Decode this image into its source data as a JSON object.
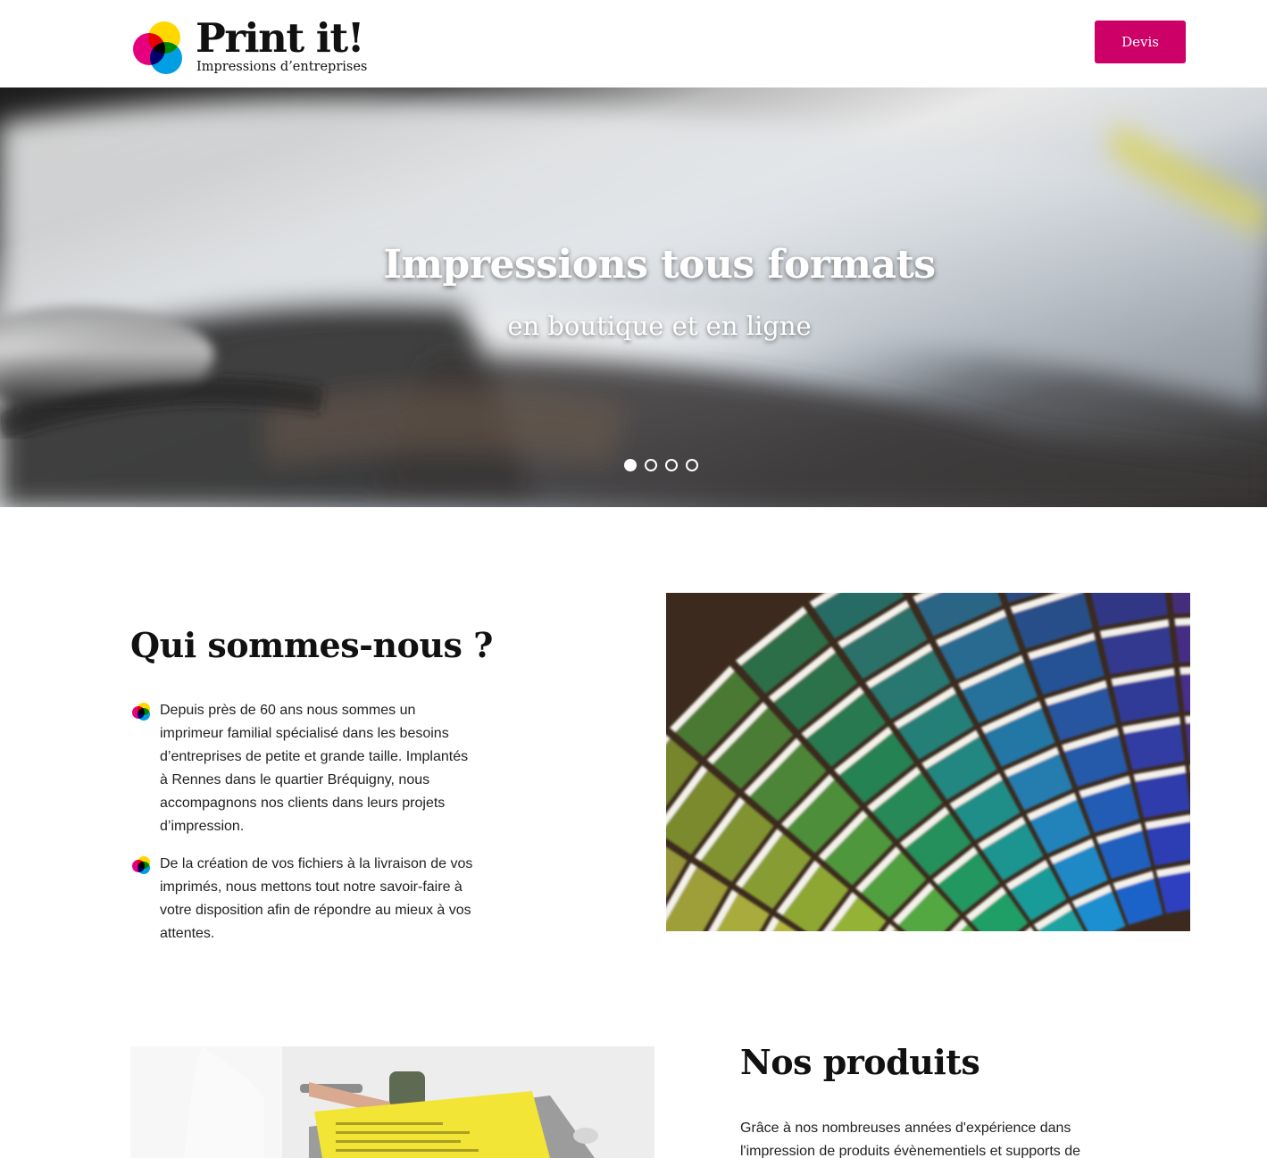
{
  "header": {
    "logo_title": "Print it!",
    "logo_subtitle": "Impressions d’entreprises",
    "cta_label": "Devis"
  },
  "hero": {
    "title": "Impressions tous formats",
    "subtitle": "en boutique et en ligne",
    "slide_count": 4,
    "active_slide": 1
  },
  "about": {
    "title": "Qui sommes-nous ?",
    "items": [
      "Depuis près de 60 ans nous sommes un imprimeur familial spécialisé dans les besoins d’entreprises de petite et grande taille. Implantés à Rennes dans le quartier Bréquigny, nous accompagnons nos clients dans leurs projets d’impression.",
      "De la création de vos fichiers à la livraison de vos imprimés, nous mettons tout notre savoir-faire à votre disposition afin de répondre au mieux à vos attentes."
    ]
  },
  "products": {
    "title": "Nos produits",
    "text": "Grâce à nos nombreuses années d'expérience dans l'impression de produits évènementiels et supports de"
  },
  "colors": {
    "brand_magenta": "#cc0066",
    "logo_yellow": "#ffd800",
    "logo_magenta": "#e6007e",
    "logo_cyan": "#009fe3"
  },
  "icons": {
    "bullet": "cmyk-circles-icon",
    "logo": "cmyk-logo-icon"
  }
}
